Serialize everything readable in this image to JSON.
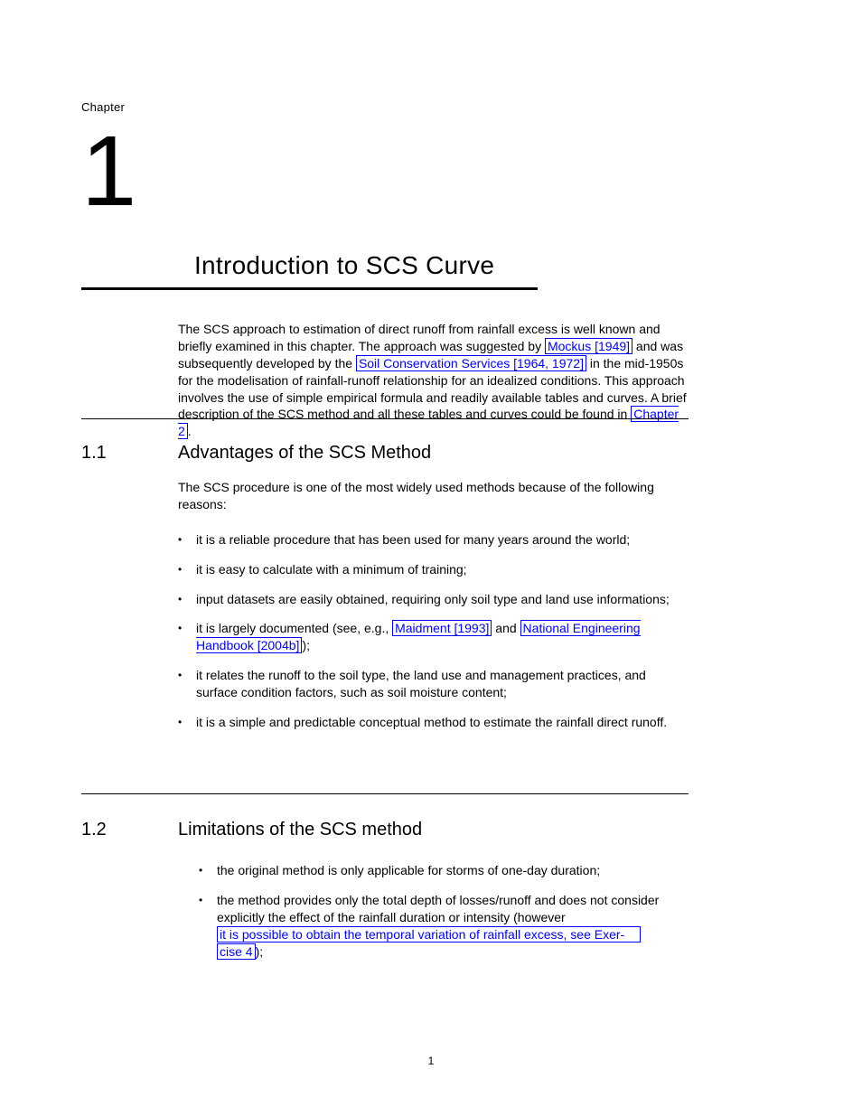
{
  "chapter": {
    "label": "Chapter",
    "number": "1",
    "title": "Introduction to SCS Curve"
  },
  "intro": {
    "p1_pre": "The SCS approach to estimation of direct runoff from rainfall excess is well known and briefly examined in this chapter. The approach was suggested by ",
    "link1": "Mockus [1949]",
    "p1_mid": " and was subsequently developed by the ",
    "link2": "Soil Conservation Services [1964, 1972]",
    "p1_end": " in the mid-1950s for the modelisation of rainfall-runoff relationship for an idealized conditions.",
    "p2": "This approach involves the use of simple empirical formula and readily available tables and curves. A brief description of the SCS method and all these tables and curves could be found in ",
    "link3": "Chapter 2"
  },
  "sec1": {
    "num": "1.1",
    "title": "Advantages of the SCS Method",
    "lead": "The SCS procedure is one of the most widely used methods because of the following reasons:",
    "items": [
      {
        "text": "it is a reliable procedure that has been used for many years around the world;"
      },
      {
        "text": "it is easy to calculate with a minimum of training;"
      },
      {
        "text": "input datasets are easily obtained, requiring only soil type and land use informations;"
      },
      {
        "text_pre": "it is largely documented (see, e.g., ",
        "link_a": "Maidment [1993]",
        "text_mid": " and ",
        "link_b": "National Engineering Handbook [2004b]",
        "text_end": ");"
      },
      {
        "text": "it relates the runoff to the soil type, the land use and management practices, and surface condition factors, such as soil moisture content;"
      },
      {
        "text": "it is a simple and predictable conceptual method to estimate the rainfall direct runoff."
      }
    ]
  },
  "sec2": {
    "num": "1.2",
    "title": "Limitations of the SCS method",
    "items": [
      {
        "text": "the original method is only applicable for storms of one-day duration;"
      },
      {
        "text_pre": "the method provides only the total depth of losses/runoff and does not consider explicitly the effect of the rainfall duration or intensity (however ",
        "link_lines": [
          "it is possible to obtain the temporal variation of rainfall excess, see Exer-",
          "cise 4"
        ],
        "text_end": ");"
      }
    ]
  },
  "footer": "1"
}
